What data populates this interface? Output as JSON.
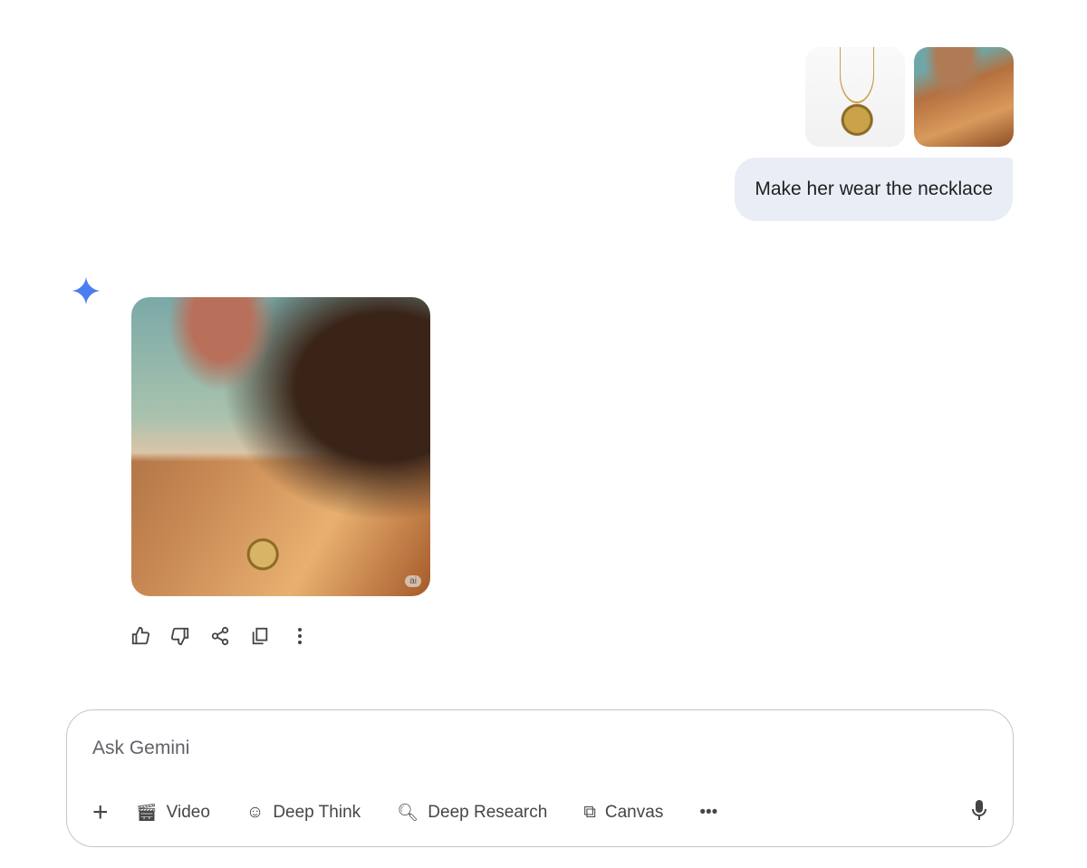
{
  "user_message": {
    "text": "Make her wear the necklace",
    "attachments": [
      "necklace-image",
      "woman-image"
    ]
  },
  "response": {
    "badge": "ai",
    "actions": [
      "thumbs-up",
      "thumbs-down",
      "share",
      "copy",
      "more"
    ]
  },
  "composer": {
    "placeholder": "Ask Gemini",
    "tools": [
      {
        "icon": "video-icon",
        "label": "Video"
      },
      {
        "icon": "deep-think-icon",
        "label": "Deep Think"
      },
      {
        "icon": "deep-research-icon",
        "label": "Deep Research"
      },
      {
        "icon": "canvas-icon",
        "label": "Canvas"
      }
    ]
  },
  "colors": {
    "accent": "#4285f4",
    "bubble": "#e9eef6"
  }
}
